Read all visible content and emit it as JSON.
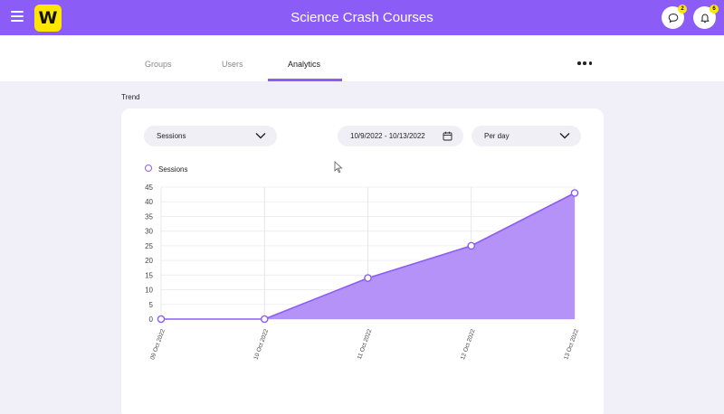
{
  "header": {
    "title": "Science Crash Courses",
    "logo_letter": "W",
    "menu_icon": "hamburger-icon",
    "messages_icon": "chat-bubble-icon",
    "messages_count": "2",
    "notifications_icon": "bell-icon",
    "notifications_count": "6",
    "brand_color": "#8b5cf6",
    "logo_color": "#ffe600"
  },
  "tabs": [
    {
      "label": "Groups",
      "active": false
    },
    {
      "label": "Users",
      "active": false
    },
    {
      "label": "Analytics",
      "active": true
    }
  ],
  "more_icon": "more-horizontal-icon",
  "section_label": "Trend",
  "filters": {
    "metric": "Sessions",
    "date_range": "10/9/2022 - 10/13/2022",
    "interval": "Per day"
  },
  "legend": {
    "label": "Sessions"
  },
  "chart_data": {
    "type": "area",
    "categories": [
      "09 Oct 2022",
      "10 Oct 2022",
      "11 Oct 2022",
      "12 Oct 2022",
      "13 Oct 2022"
    ],
    "series": [
      {
        "name": "Sessions",
        "values": [
          0,
          0,
          14,
          25,
          43
        ],
        "color": "#8b5cf6"
      }
    ],
    "ylim": [
      0,
      45
    ],
    "yticks": [
      0,
      5,
      10,
      15,
      20,
      25,
      30,
      35,
      40,
      45
    ],
    "grid": true,
    "legend_position": "top-left"
  }
}
